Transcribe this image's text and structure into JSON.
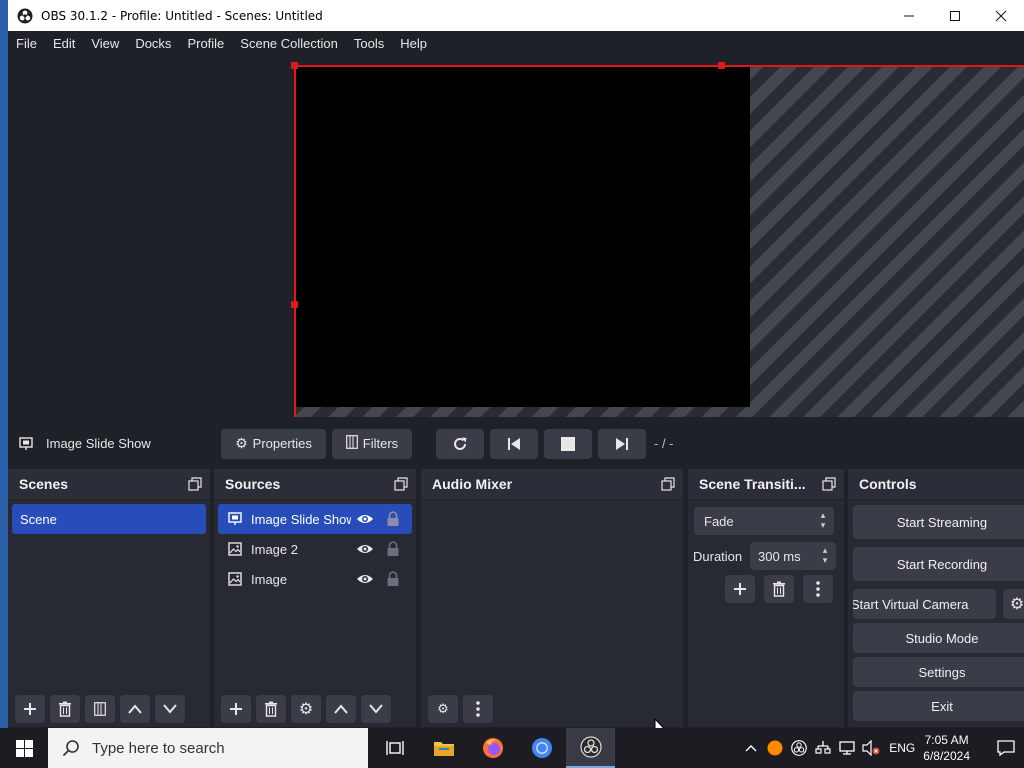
{
  "window": {
    "title": "OBS 30.1.2 - Profile: Untitled - Scenes: Untitled",
    "minimize": "—",
    "maximize": "☐",
    "close": "✕"
  },
  "menu": [
    "File",
    "Edit",
    "View",
    "Docks",
    "Profile",
    "Scene Collection",
    "Tools",
    "Help"
  ],
  "context_bar": {
    "source_name": "Image Slide Show",
    "properties_label": "Properties",
    "filters_label": "Filters",
    "time_text": "- / -"
  },
  "docks": {
    "scenes": {
      "title": "Scenes",
      "items": [
        "Scene"
      ]
    },
    "sources": {
      "title": "Sources",
      "items": [
        {
          "name": "Image Slide Show",
          "icon": "slideshow-icon",
          "selected": true
        },
        {
          "name": "Image 2",
          "icon": "image-icon",
          "selected": false
        },
        {
          "name": "Image",
          "icon": "image-icon",
          "selected": false
        }
      ]
    },
    "mixer": {
      "title": "Audio Mixer"
    },
    "transitions": {
      "title": "Scene Transiti...",
      "selected": "Fade",
      "duration_label": "Duration",
      "duration_value": "300 ms"
    },
    "controls": {
      "title": "Controls",
      "start_streaming": "Start Streaming",
      "start_recording": "Start Recording",
      "start_virtual_camera": "Start Virtual Camera",
      "studio_mode": "Studio Mode",
      "settings": "Settings",
      "exit": "Exit"
    }
  },
  "taskbar": {
    "search_placeholder": "Type here to search",
    "language": "ENG",
    "time": "7:05 AM",
    "date": "6/8/2024"
  },
  "colors": {
    "accent_blue": "#284cb8",
    "selection_red": "#e01818",
    "panel_bg": "#2b2e38",
    "window_bg": "#1f2129"
  }
}
